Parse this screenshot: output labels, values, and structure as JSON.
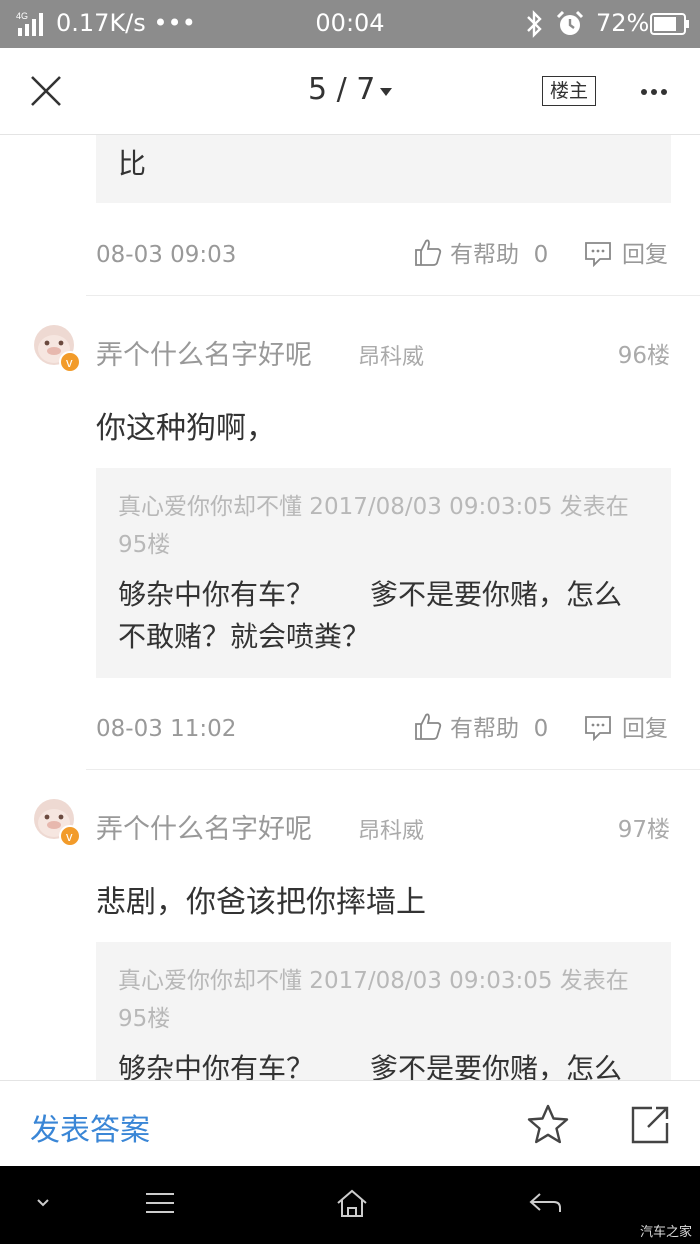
{
  "status_bar": {
    "network_type": "4G",
    "net_speed": "0.17K/s •••",
    "time": "00:04",
    "battery": "72%"
  },
  "top_nav": {
    "page_indicator": "5 / 7",
    "owner_label": "楼主"
  },
  "posts": [
    {
      "quote_tail": "比",
      "time": "08-03 09:03",
      "helpful_label": "有帮助",
      "helpful_count": "0",
      "reply_label": "回复"
    },
    {
      "user": "弄个什么名字好呢",
      "car": "昂科威",
      "floor": "96楼",
      "text": "你这种狗啊，",
      "quote_meta_line1": "真心爱你你却不懂 2017/08/03 09:03:05 发表在",
      "quote_meta_line2": "95楼",
      "quote_line1": "够杂中你有车？　　爹不是要你赌，怎么",
      "quote_line2": "不敢赌？就会喷粪？",
      "time": "08-03 11:02",
      "helpful_label": "有帮助",
      "helpful_count": "0",
      "reply_label": "回复"
    },
    {
      "user": "弄个什么名字好呢",
      "car": "昂科威",
      "floor": "97楼",
      "text": "悲剧，你爸该把你摔墙上",
      "quote_meta_line1": "真心爱你你却不懂 2017/08/03 09:03:05 发表在",
      "quote_meta_line2": "95楼",
      "quote_line1": "够杂中你有车？　　爹不是要你赌，怎么"
    }
  ],
  "action_bar": {
    "answer_label": "发表答案"
  },
  "watermark": "汽车之家",
  "colors": {
    "status_bar_bg": "#8c8c8c",
    "link_blue": "#3a86d6",
    "quote_bg": "#f4f4f4",
    "verified_orange": "#f29b2a"
  },
  "icons": [
    "signal-icon",
    "bluetooth-icon",
    "alarm-icon",
    "battery-icon",
    "close-icon",
    "caret-down-icon",
    "more-icon",
    "thumb-up-icon",
    "reply-icon",
    "star-icon",
    "share-icon",
    "nav-collapse-icon",
    "nav-menu-icon",
    "nav-home-icon",
    "nav-back-icon"
  ]
}
